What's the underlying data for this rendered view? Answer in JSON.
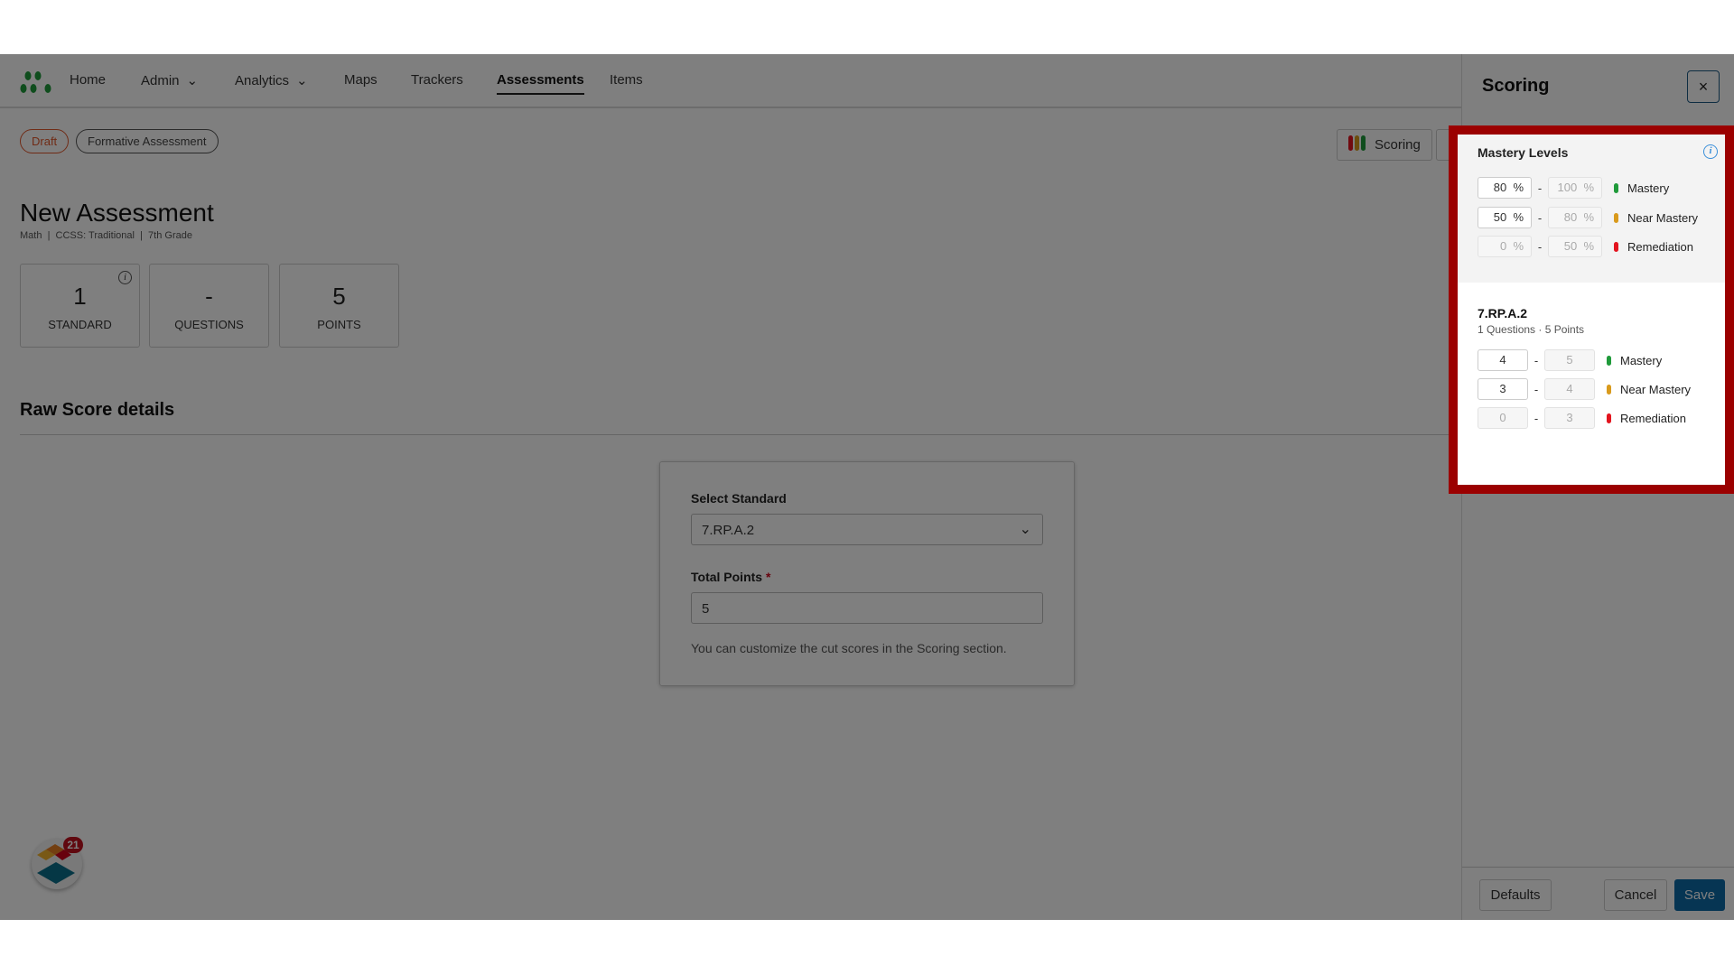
{
  "nav": {
    "items": [
      {
        "label": "Home"
      },
      {
        "label": "Admin",
        "dropdown": true
      },
      {
        "label": "Analytics",
        "dropdown": true
      },
      {
        "label": "Maps"
      },
      {
        "label": "Trackers"
      },
      {
        "label": "Assessments",
        "active": true
      },
      {
        "label": "Items"
      }
    ]
  },
  "badges": {
    "status": "Draft",
    "type": "Formative Assessment"
  },
  "assessment": {
    "title": "New Assessment",
    "meta": "Math  |  CCSS: Traditional  |  7th Grade"
  },
  "stats": [
    {
      "value": "1",
      "label": "STANDARD"
    },
    {
      "value": "-",
      "label": "QUESTIONS"
    },
    {
      "value": "5",
      "label": "POINTS"
    }
  ],
  "section_title": "Raw Score details",
  "form": {
    "standard_label": "Select Standard",
    "standard_value": "7.RP.A.2",
    "points_label": "Total Points",
    "required": "*",
    "points_value": "5",
    "help": "You can customize the cut scores in the Scoring section."
  },
  "toolbar": {
    "scoring_label": "Scoring"
  },
  "notifications": {
    "count": "21"
  },
  "scoring": {
    "title": "Scoring",
    "close": "×",
    "mastery_title": "Mastery Levels",
    "levels": [
      {
        "from": "80",
        "to": "100",
        "unit": "%",
        "label": "Mastery",
        "color": "#1f9a3a"
      },
      {
        "from": "50",
        "to": "80",
        "unit": "%",
        "label": "Near Mastery",
        "color": "#d99a1c"
      },
      {
        "from": "0",
        "to": "50",
        "unit": "%",
        "label": "Remediation",
        "color": "#e3141e"
      }
    ],
    "standard": {
      "code": "7.RP.A.2",
      "summary": "1 Questions · 5 Points",
      "levels": [
        {
          "from": "4",
          "to": "5",
          "label": "Mastery"
        },
        {
          "from": "3",
          "to": "4",
          "label": "Near Mastery"
        },
        {
          "from": "0",
          "to": "3",
          "label": "Remediation"
        }
      ]
    },
    "footer": {
      "defaults": "Defaults",
      "cancel": "Cancel",
      "save": "Save"
    }
  },
  "colors": {
    "save": "#0d6aa6",
    "highlight": "#9b0000",
    "draft": "#e0562b"
  }
}
